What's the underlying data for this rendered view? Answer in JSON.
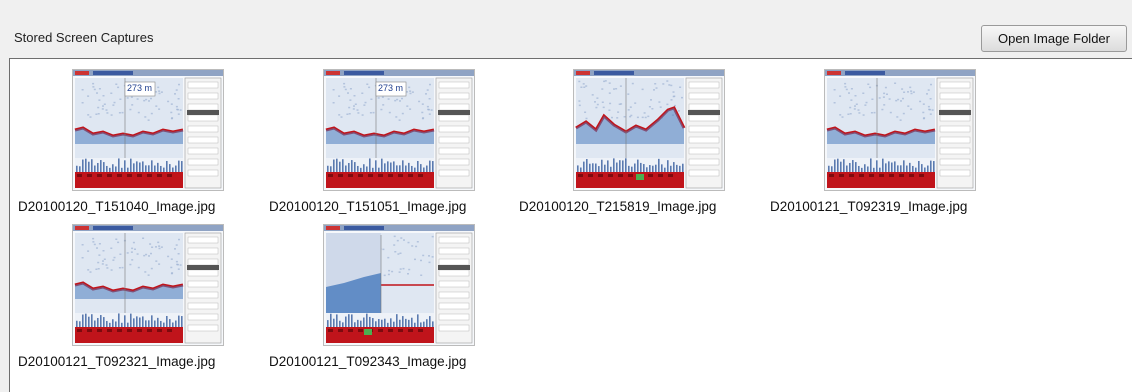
{
  "header": {
    "title": "Stored Screen Captures",
    "open_button_label": "Open Image Folder"
  },
  "thumbnails": [
    {
      "filename": "D20100120_T151040_Image.jpg",
      "overlay_text": "273 m",
      "variant": "a"
    },
    {
      "filename": "D20100120_T151051_Image.jpg",
      "overlay_text": "273 m",
      "variant": "a"
    },
    {
      "filename": "D20100120_T215819_Image.jpg",
      "overlay_text": "",
      "variant": "b"
    },
    {
      "filename": "D20100121_T092319_Image.jpg",
      "overlay_text": "",
      "variant": "a"
    },
    {
      "filename": "D20100121_T092321_Image.jpg",
      "overlay_text": "",
      "variant": "a"
    },
    {
      "filename": "D20100121_T092343_Image.jpg",
      "overlay_text": "",
      "variant": "c"
    }
  ],
  "colors": {
    "echo_red": "#c0141b",
    "echo_blue": "#4f7fc0",
    "echo_light": "#dfe7f2"
  }
}
